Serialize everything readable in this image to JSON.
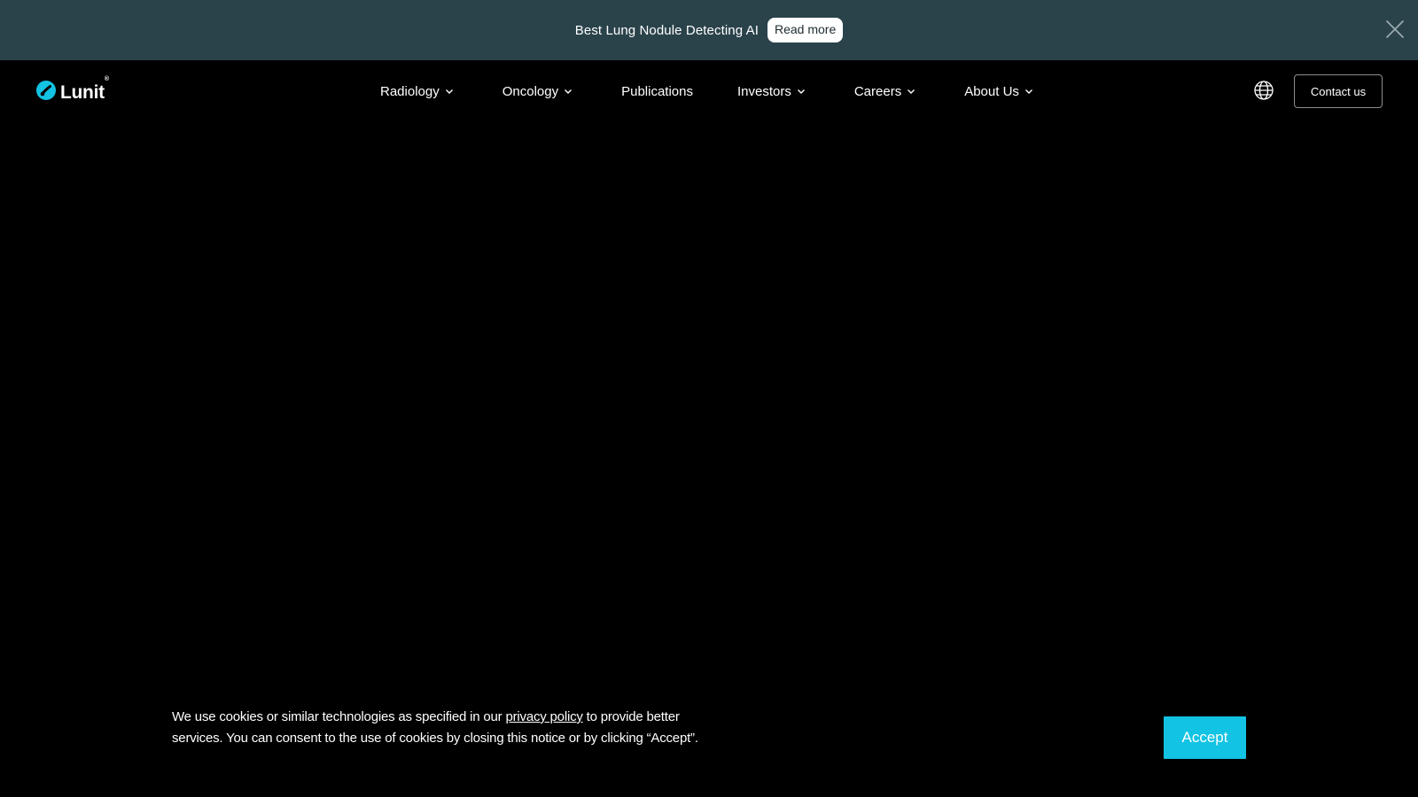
{
  "banner": {
    "text": "Best Lung Nodule Detecting AI",
    "button_label": "Read more",
    "close_icon": "close-icon"
  },
  "header": {
    "logo_text": "Lunit",
    "logo_mark": "®",
    "nav": [
      {
        "label": "Radiology",
        "has_dropdown": true
      },
      {
        "label": "Oncology",
        "has_dropdown": true
      },
      {
        "label": "Publications",
        "has_dropdown": false
      },
      {
        "label": "Investors",
        "has_dropdown": true
      },
      {
        "label": "Careers",
        "has_dropdown": true
      },
      {
        "label": "About Us",
        "has_dropdown": true
      }
    ],
    "language_icon": "globe-icon",
    "contact_label": "Contact us"
  },
  "cookie": {
    "text_before": "We use cookies or similar technologies as specified in our ",
    "link_text": "privacy policy",
    "text_after": " to provide better services. You can consent to the use of cookies by closing this notice or by clicking “Accept”.",
    "accept_label": "Accept"
  },
  "colors": {
    "banner_bg": "#2a434b",
    "page_bg": "#000000",
    "accent": "#12c3e3",
    "logo_mark": "#12c3e3"
  }
}
